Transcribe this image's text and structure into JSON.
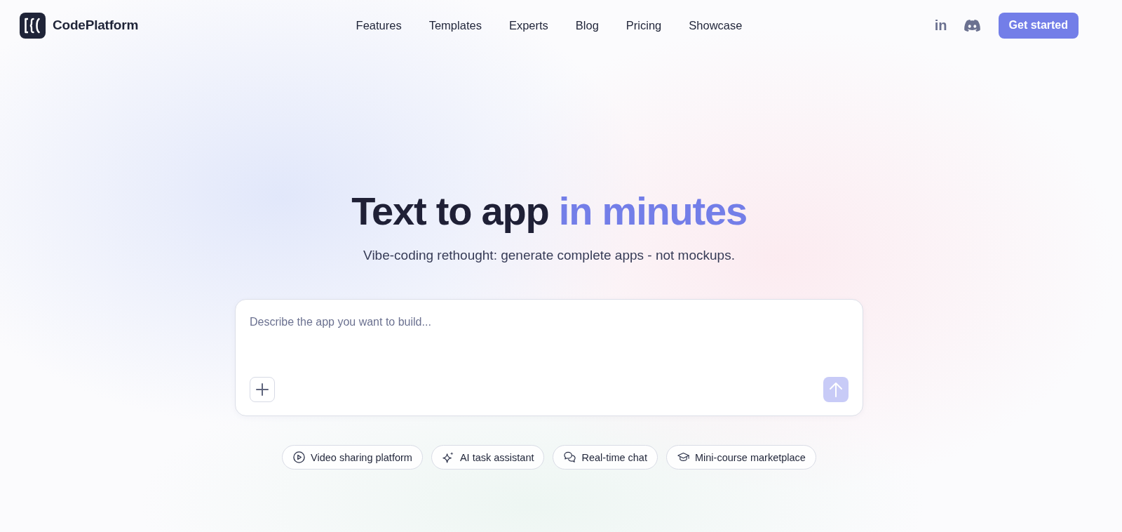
{
  "header": {
    "brand": "CodePlatform",
    "nav": [
      "Features",
      "Templates",
      "Experts",
      "Blog",
      "Pricing",
      "Showcase"
    ],
    "social_link_text": "in",
    "cta": "Get started"
  },
  "hero": {
    "title": "Text to app",
    "title_highlight": "in minutes",
    "subtitle": "Vibe-coding rethought: generate complete apps - not mockups."
  },
  "prompt": {
    "placeholder": "Describe the app you want to build...",
    "send_disabled": true
  },
  "suggestions": [
    {
      "kind": "video",
      "label": "Video sharing platform"
    },
    {
      "kind": "sparkle",
      "label": "AI task assistant"
    },
    {
      "kind": "chat",
      "label": "Real-time chat"
    },
    {
      "kind": "course",
      "label": "Mini-course marketplace"
    }
  ]
}
